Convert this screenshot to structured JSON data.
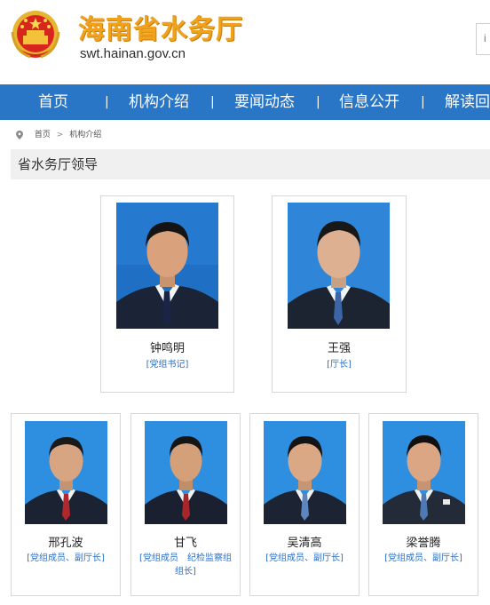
{
  "site": {
    "title": "海南省水务厅",
    "url": "swt.hainan.gov.cn",
    "search_stub": "i"
  },
  "nav": {
    "items": [
      {
        "label": "首页"
      },
      {
        "label": "机构介绍"
      },
      {
        "label": "要闻动态"
      },
      {
        "label": "信息公开"
      },
      {
        "label": "解读回"
      }
    ],
    "separator": "|"
  },
  "breadcrumb": {
    "home": "首页",
    "separator": ">",
    "current": "机构介绍"
  },
  "section": {
    "title": "省水务厅领导"
  },
  "leaders": [
    {
      "name": "钟鸣明",
      "title": "[党组书记]"
    },
    {
      "name": "王强",
      "title": "[厅长]"
    },
    {
      "name": "邢孔波",
      "title": "[党组成员、副厅长]"
    },
    {
      "name": "甘飞",
      "title": "[党组成员　纪检监察组组长]"
    },
    {
      "name": "吴清高",
      "title": "[党组成员、副厅长]"
    },
    {
      "name": "梁誉腾",
      "title": "[党组成员、副厅长]"
    }
  ],
  "colors": {
    "nav_bg": "#2a76c6",
    "title_gold": "#f0a21c",
    "title_link_blue": "#2a6fc4",
    "photo_bg_blue": "#2e8fe0"
  }
}
